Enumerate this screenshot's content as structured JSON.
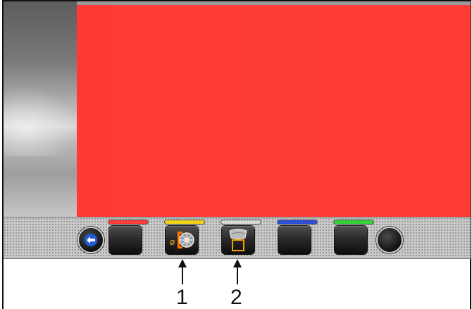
{
  "toolbar": {
    "back_button": {
      "icon": "back-arrow-icon"
    },
    "softkeys": [
      {
        "color": "#ff3b3b",
        "icon": ""
      },
      {
        "color": "#f2d21a",
        "icon": "rim-diameter-icon"
      },
      {
        "color": "#d6d6d6",
        "icon": "wheel-profile-icon"
      },
      {
        "color": "#2f4fd8",
        "icon": ""
      },
      {
        "color": "#32d33a",
        "icon": ""
      }
    ],
    "right_button": {
      "icon": ""
    }
  },
  "callouts": [
    {
      "label": "1"
    },
    {
      "label": "2"
    }
  ],
  "colors": {
    "screen_red": "#ff3b36",
    "arrow_blue": "#1e5bd8"
  }
}
